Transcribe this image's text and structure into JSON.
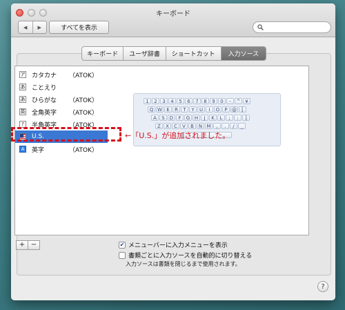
{
  "window": {
    "title": "キーボード",
    "show_all_label": "すべてを表示",
    "back_glyph": "◀",
    "forward_glyph": "▶",
    "search_icon": "magnifier-icon"
  },
  "tabs": [
    {
      "label": "キーボード",
      "selected": false
    },
    {
      "label": "ユーザ辞書",
      "selected": false
    },
    {
      "label": "ショートカット",
      "selected": false
    },
    {
      "label": "入力ソース",
      "selected": true
    }
  ],
  "input_sources": [
    {
      "icon": "ア",
      "label": "カタカナ",
      "suffix": "（ATOK）",
      "selected": false
    },
    {
      "icon": "あ",
      "label": "ことえり",
      "suffix": "",
      "selected": false
    },
    {
      "icon": "あ",
      "label": "ひらがな",
      "suffix": "（ATOK）",
      "selected": false
    },
    {
      "icon": "英",
      "label": "全角英字",
      "suffix": "（ATOK）",
      "selected": false
    },
    {
      "icon": "ｱ",
      "label": "半角英字",
      "suffix": "（ATOK）",
      "selected": false
    },
    {
      "icon": "us-flag-icon",
      "label": "U.S.",
      "suffix": "",
      "selected": true
    },
    {
      "icon": "A",
      "label": "英字",
      "suffix": "（ATOK）",
      "selected": false
    }
  ],
  "keyboard_rows": [
    [
      "1",
      "2",
      "3",
      "4",
      "5",
      "6",
      "7",
      "8",
      "9",
      "0",
      "-",
      "^",
      "¥"
    ],
    [
      "Q",
      "W",
      "E",
      "R",
      "T",
      "Y",
      "U",
      "I",
      "O",
      "P",
      "@",
      "["
    ],
    [
      "A",
      "S",
      "D",
      "F",
      "G",
      "H",
      "J",
      "K",
      "L",
      ";",
      ":",
      "]"
    ],
    [
      "Z",
      "X",
      "C",
      "V",
      "B",
      "N",
      "M",
      ",",
      ".",
      "/",
      "_"
    ]
  ],
  "annotation": {
    "text": "←「U.S.」が追加されました。",
    "color": "#d4101c"
  },
  "list_buttons": {
    "add": "+",
    "remove": "−"
  },
  "options": {
    "show_menu_label": "メニューバーに入力メニューを表示",
    "show_menu_checked": true,
    "auto_switch_label": "書類ごとに入力ソースを自動的に切り替える",
    "auto_switch_checked": false,
    "note": "入力ソースは書類を閉じるまで使用されます。"
  },
  "help_label": "?",
  "colors": {
    "selection": "#3a78d4",
    "desktop": "#3f7f86"
  }
}
